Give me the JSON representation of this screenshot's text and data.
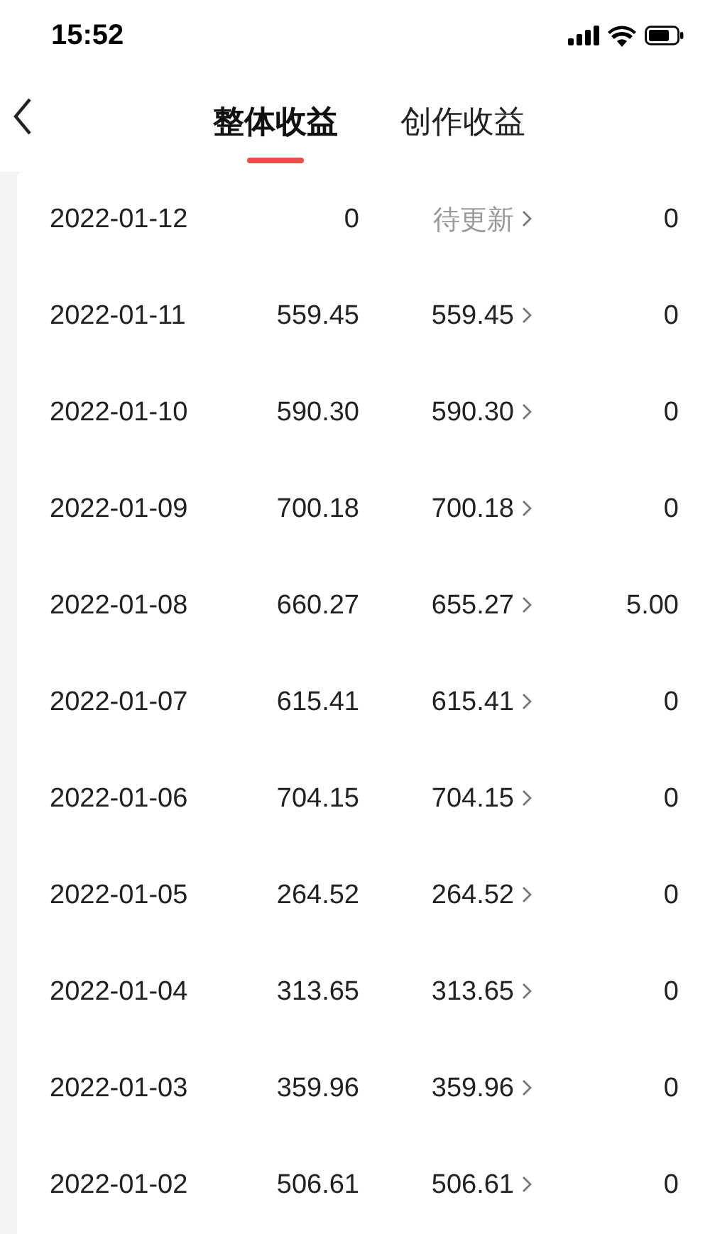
{
  "status_bar": {
    "time": "15:52"
  },
  "tabs": [
    {
      "label": "整体收益",
      "selected": true
    },
    {
      "label": "创作收益",
      "selected": false
    }
  ],
  "rows": [
    {
      "date": "2022-01-12",
      "column_2": "0",
      "column_3": "待更新",
      "pending": true,
      "column_4": "0"
    },
    {
      "date": "2022-01-11",
      "column_2": "559.45",
      "column_3": "559.45",
      "pending": false,
      "column_4": "0"
    },
    {
      "date": "2022-01-10",
      "column_2": "590.30",
      "column_3": "590.30",
      "pending": false,
      "column_4": "0"
    },
    {
      "date": "2022-01-09",
      "column_2": "700.18",
      "column_3": "700.18",
      "pending": false,
      "column_4": "0"
    },
    {
      "date": "2022-01-08",
      "column_2": "660.27",
      "column_3": "655.27",
      "pending": false,
      "column_4": "5.00"
    },
    {
      "date": "2022-01-07",
      "column_2": "615.41",
      "column_3": "615.41",
      "pending": false,
      "column_4": "0"
    },
    {
      "date": "2022-01-06",
      "column_2": "704.15",
      "column_3": "704.15",
      "pending": false,
      "column_4": "0"
    },
    {
      "date": "2022-01-05",
      "column_2": "264.52",
      "column_3": "264.52",
      "pending": false,
      "column_4": "0"
    },
    {
      "date": "2022-01-04",
      "column_2": "313.65",
      "column_3": "313.65",
      "pending": false,
      "column_4": "0"
    },
    {
      "date": "2022-01-03",
      "column_2": "359.96",
      "column_3": "359.96",
      "pending": false,
      "column_4": "0"
    },
    {
      "date": "2022-01-02",
      "column_2": "506.61",
      "column_3": "506.61",
      "pending": false,
      "column_4": "0"
    }
  ]
}
